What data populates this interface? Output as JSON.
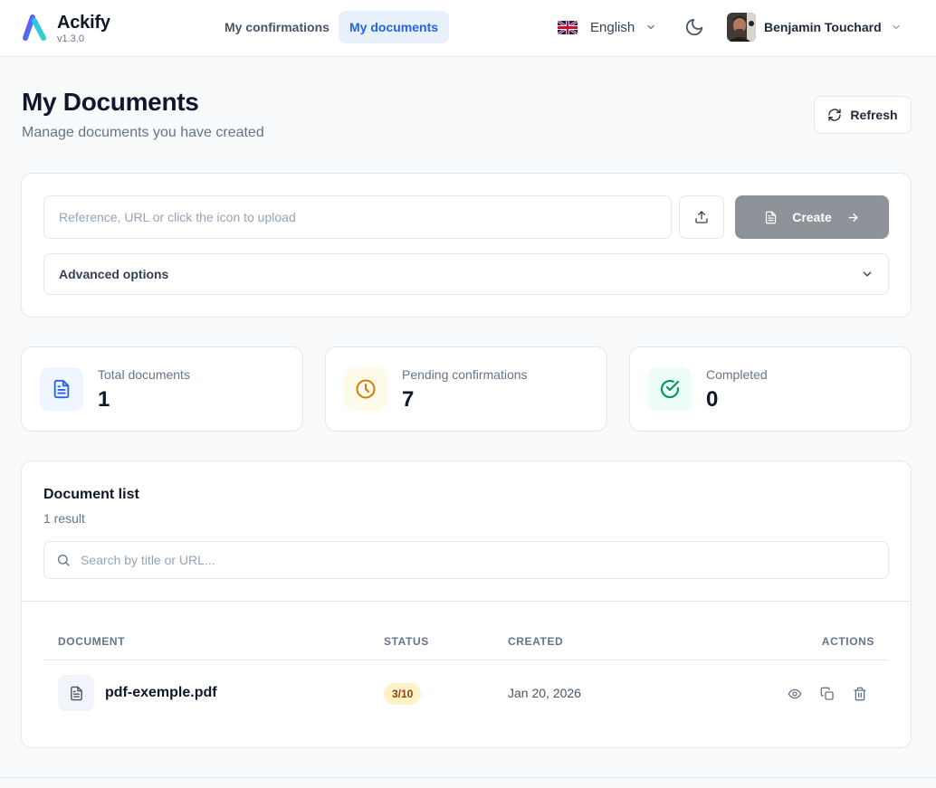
{
  "brand": {
    "name": "Ackify",
    "version": "v1.3.0"
  },
  "nav": {
    "tabs": [
      {
        "label": "My confirmations",
        "active": false
      },
      {
        "label": "My documents",
        "active": true
      }
    ]
  },
  "language": {
    "label": "English",
    "flag_icon": "uk-flag-icon"
  },
  "theme": {
    "icon": "moon-icon"
  },
  "user": {
    "name": "Benjamin Touchard",
    "avatar_icon": "user-avatar"
  },
  "page": {
    "title": "My Documents",
    "subtitle": "Manage documents you have created",
    "refresh_label": "Refresh"
  },
  "create": {
    "input_placeholder": "Reference, URL or click the icon to upload",
    "input_value": "",
    "create_label": "Create",
    "advanced_label": "Advanced options"
  },
  "stats": [
    {
      "label": "Total documents",
      "value": "1",
      "icon": "document-icon",
      "color": "#2563eb",
      "bg": "#eff6ff"
    },
    {
      "label": "Pending confirmations",
      "value": "7",
      "icon": "clock-icon",
      "color": "#d97706",
      "bg": "#fffbeb"
    },
    {
      "label": "Completed",
      "value": "0",
      "icon": "check-circle-icon",
      "color": "#059669",
      "bg": "#ecfdf5"
    }
  ],
  "list": {
    "title": "Document list",
    "count": "1 result",
    "search_placeholder": "Search by title or URL...",
    "columns": [
      "DOCUMENT",
      "STATUS",
      "CREATED",
      "ACTIONS"
    ],
    "rows": [
      {
        "name": "pdf-exemple.pdf",
        "status": "3/10",
        "created": "Jan 20, 2026",
        "actions": [
          "view-icon",
          "copy-icon",
          "trash-icon"
        ]
      }
    ]
  },
  "colors": {
    "accent": "#2563eb",
    "accent_bg": "#e8f0fc",
    "create_button": "#8e9399",
    "badge_bg": "#fef3c7",
    "badge_text": "#92400e"
  }
}
